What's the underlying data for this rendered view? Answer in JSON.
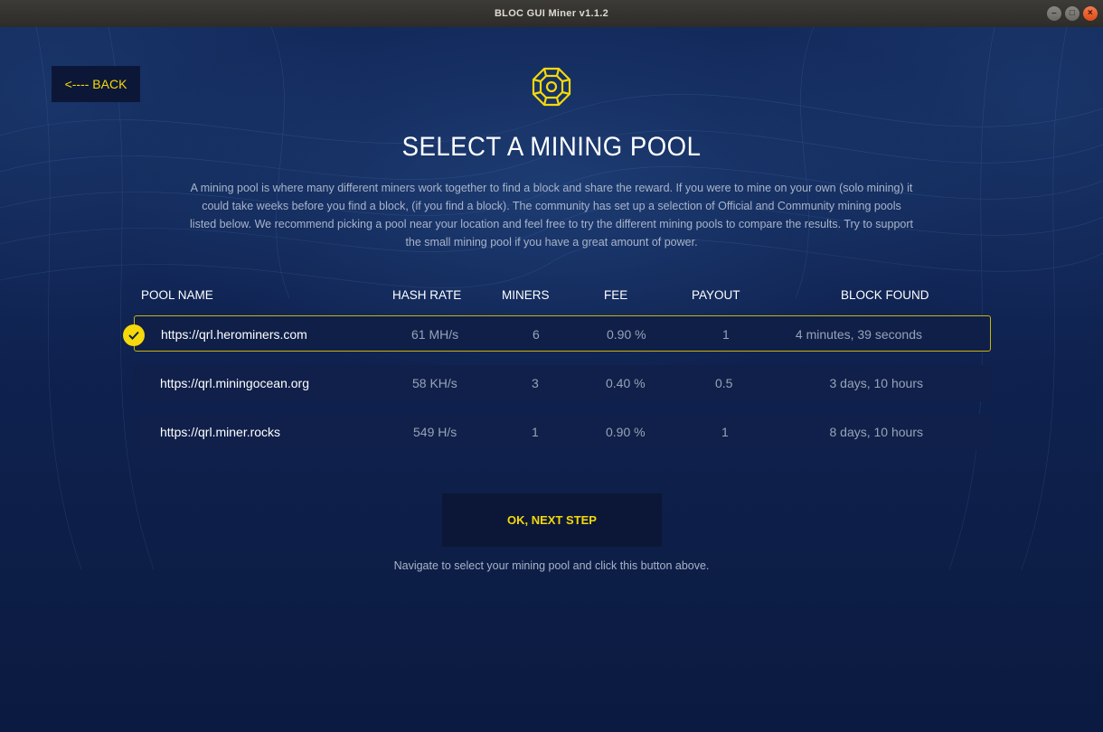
{
  "window": {
    "title": "BLOC GUI Miner v1.1.2"
  },
  "back_button": {
    "label": "<---- BACK"
  },
  "logo": {
    "icon": "bloc-chip-icon",
    "color": "#f5d90a"
  },
  "page": {
    "title": "SELECT A MINING POOL",
    "description": "A mining pool is where many different miners work together to find a block and share the reward. If you were to mine on your own (solo mining) it could take weeks before you find a block, (if you find a block). The community has set up a selection of Official and Community mining pools listed below. We recommend picking a pool near your location and feel free to try the different mining pools to compare the results. Try to support the small mining pool if you have a great amount of power."
  },
  "table": {
    "headers": {
      "pool_name": "POOL NAME",
      "hash_rate": "HASH RATE",
      "miners": "MINERS",
      "fee": "FEE",
      "payout": "PAYOUT",
      "block_found": "BLOCK FOUND"
    },
    "rows": [
      {
        "url": "https://qrl.herominers.com",
        "hash_rate": "61 MH/s",
        "miners": "6",
        "fee": "0.90 %",
        "payout": "1",
        "block_found": "4 minutes, 39 seconds",
        "selected": true
      },
      {
        "url": "https://qrl.miningocean.org",
        "hash_rate": "58 KH/s",
        "miners": "3",
        "fee": "0.40 %",
        "payout": "0.5",
        "block_found": "3 days, 10 hours",
        "selected": false
      },
      {
        "url": "https://qrl.miner.rocks",
        "hash_rate": "549 H/s",
        "miners": "1",
        "fee": "0.90 %",
        "payout": "1",
        "block_found": "8 days, 10 hours",
        "selected": false
      }
    ]
  },
  "next_button": {
    "label": "OK, NEXT STEP"
  },
  "hint": "Navigate to select your mining pool and click this button above.",
  "colors": {
    "accent": "#f5d90a",
    "background": "#0e2148",
    "row": "#10204a",
    "button": "#0c1737"
  }
}
